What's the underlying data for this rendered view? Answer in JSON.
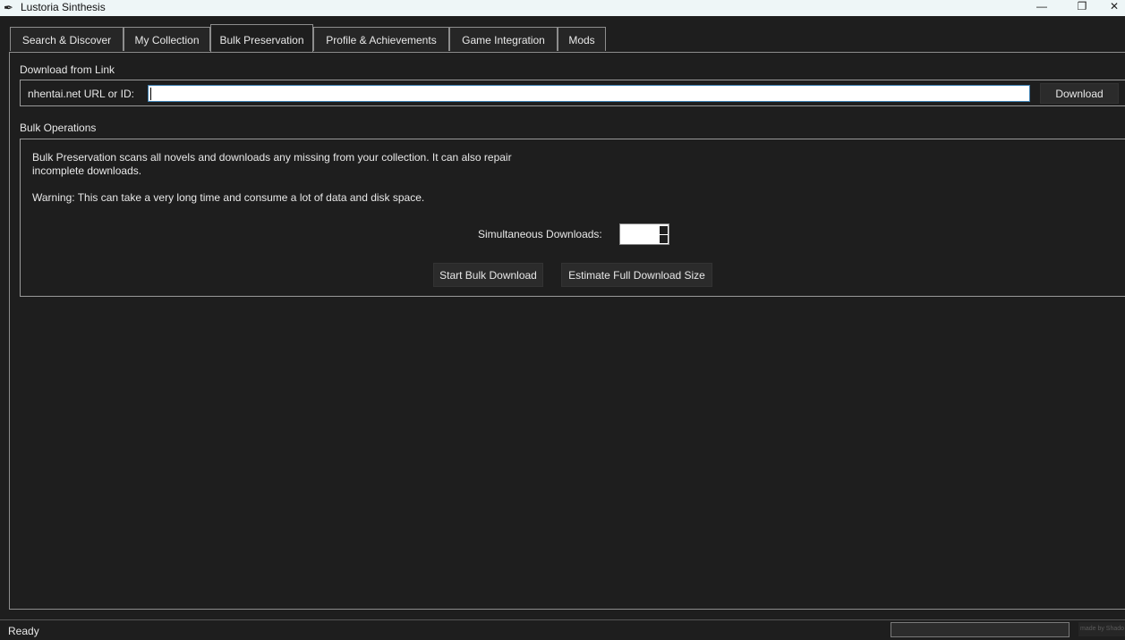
{
  "window": {
    "title": "Lustoria Sinthesis",
    "app_icon": "quill-icon",
    "controls": {
      "minimize": "—",
      "maximize": "❐",
      "close": "✕"
    }
  },
  "tabs": [
    {
      "label": "Search & Discover",
      "active": false
    },
    {
      "label": "My Collection",
      "active": false
    },
    {
      "label": "Bulk Preservation",
      "active": true
    },
    {
      "label": "Profile & Achievements",
      "active": false
    },
    {
      "label": "Game Integration",
      "active": false
    },
    {
      "label": "Mods",
      "active": false
    }
  ],
  "download_link": {
    "section_title": "Download from Link",
    "url_label": "nhentai.net URL or ID:",
    "url_value": "",
    "download_button": "Download"
  },
  "bulk": {
    "section_title": "Bulk Operations",
    "description_line1": "Bulk Preservation scans all novels and downloads any missing from your collection. It can also repair",
    "description_line2": "incomplete downloads.",
    "warning": "Warning: This can take a very long time and consume a lot of data and disk space.",
    "simultaneous_label": "Simultaneous Downloads:",
    "simultaneous_value": "",
    "start_button": "Start Bulk Download",
    "estimate_button": "Estimate Full Download Size"
  },
  "status": {
    "text": "Ready",
    "progress": 0,
    "made_by": "made by Shado"
  },
  "colors": {
    "background": "#1e1e1e",
    "border": "#8d8d8d",
    "input_focus": "#3c7fb1",
    "titlebar": "#eef6f7"
  }
}
